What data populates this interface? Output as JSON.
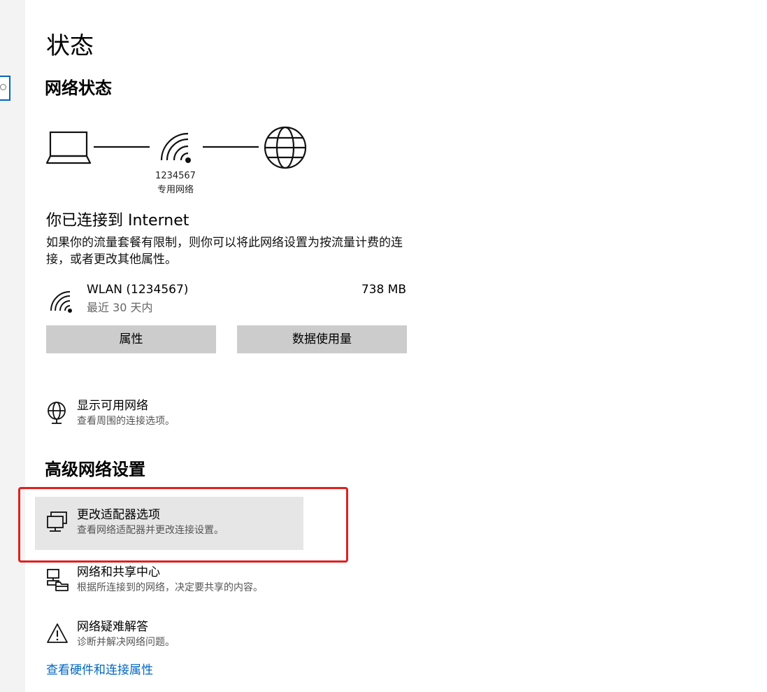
{
  "page_title": "状态",
  "network_status": {
    "heading": "网络状态",
    "network_name": "1234567",
    "network_type": "专用网络",
    "connected_title": "你已连接到 Internet",
    "connected_desc": "如果你的流量套餐有限制，则你可以将此网络设置为按流量计费的连接，或者更改其他属性。",
    "wlan_name": "WLAN (1234567)",
    "wlan_period": "最近 30 天内",
    "wlan_usage": "738 MB",
    "properties_button": "属性",
    "data_usage_button": "数据使用量",
    "show_networks_title": "显示可用网络",
    "show_networks_desc": "查看周围的连接选项。"
  },
  "advanced": {
    "heading": "高级网络设置",
    "items": [
      {
        "title": "更改适配器选项",
        "desc": "查看网络适配器并更改连接设置。"
      },
      {
        "title": "网络和共享中心",
        "desc": "根据所连接到的网络，决定要共享的内容。"
      },
      {
        "title": "网络疑难解答",
        "desc": "诊断并解决网络问题。"
      }
    ],
    "hardware_link": "查看硬件和连接属性"
  },
  "colors": {
    "accent": "#0067c0",
    "highlight_border": "#e02020",
    "button_bg": "#cccccc"
  },
  "icons": [
    "laptop-icon",
    "wifi-icon",
    "globe-icon",
    "globe-monitor-icon",
    "adapter-icon",
    "sharing-center-icon",
    "warning-icon"
  ]
}
